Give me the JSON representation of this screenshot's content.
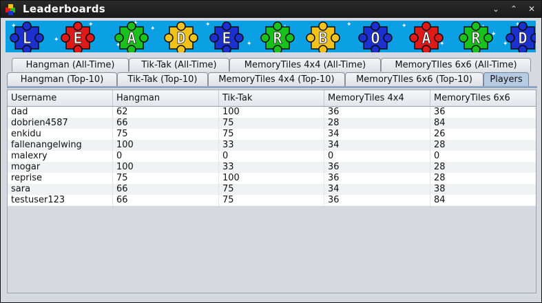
{
  "window": {
    "title": "Leaderboards",
    "controls": [
      "⌄",
      "⌃",
      "✕"
    ]
  },
  "banner": {
    "letters": [
      "L",
      "E",
      "A",
      "D",
      "E",
      "R",
      "B",
      "O",
      "A",
      "R",
      "D"
    ],
    "piece_colors": [
      "#1c2fcf",
      "#e01919",
      "#18c21b",
      "#f2c21a",
      "#1c2fcf",
      "#18c21b",
      "#f2c21a",
      "#1c2fcf",
      "#e01919",
      "#18c21b"
    ]
  },
  "tabs": {
    "row1": [
      "Hangman (All-Time)",
      "Tik-Tak (All-Time)",
      "MemoryTiles 4x4 (All-Time)",
      "MemoryTIles 6x6 (All-Time)"
    ],
    "row2": [
      "Hangman (Top-10)",
      "Tik-Tak (Top-10)",
      "MemoryTiles 4x4 (Top-10)",
      "MemoryTIles 6x6 (Top-10)",
      "Players"
    ],
    "active": "Players"
  },
  "table": {
    "columns": [
      "Username",
      "Hangman",
      "Tik-Tak",
      "MemoryTiles 4x4",
      "MemoryTiles 6x6"
    ],
    "rows": [
      [
        "dad",
        "62",
        "100",
        "36",
        "36"
      ],
      [
        "dobrien4587",
        "66",
        "75",
        "28",
        "84"
      ],
      [
        "enkidu",
        "75",
        "75",
        "34",
        "26"
      ],
      [
        "fallenangelwing",
        "100",
        "33",
        "34",
        "28"
      ],
      [
        "malexry",
        "0",
        "0",
        "0",
        "0"
      ],
      [
        "mogar",
        "100",
        "33",
        "36",
        "28"
      ],
      [
        "reprise",
        "75",
        "100",
        "36",
        "28"
      ],
      [
        "sara",
        "66",
        "75",
        "34",
        "38"
      ],
      [
        "testuser123",
        "66",
        "75",
        "36",
        "84"
      ]
    ]
  }
}
